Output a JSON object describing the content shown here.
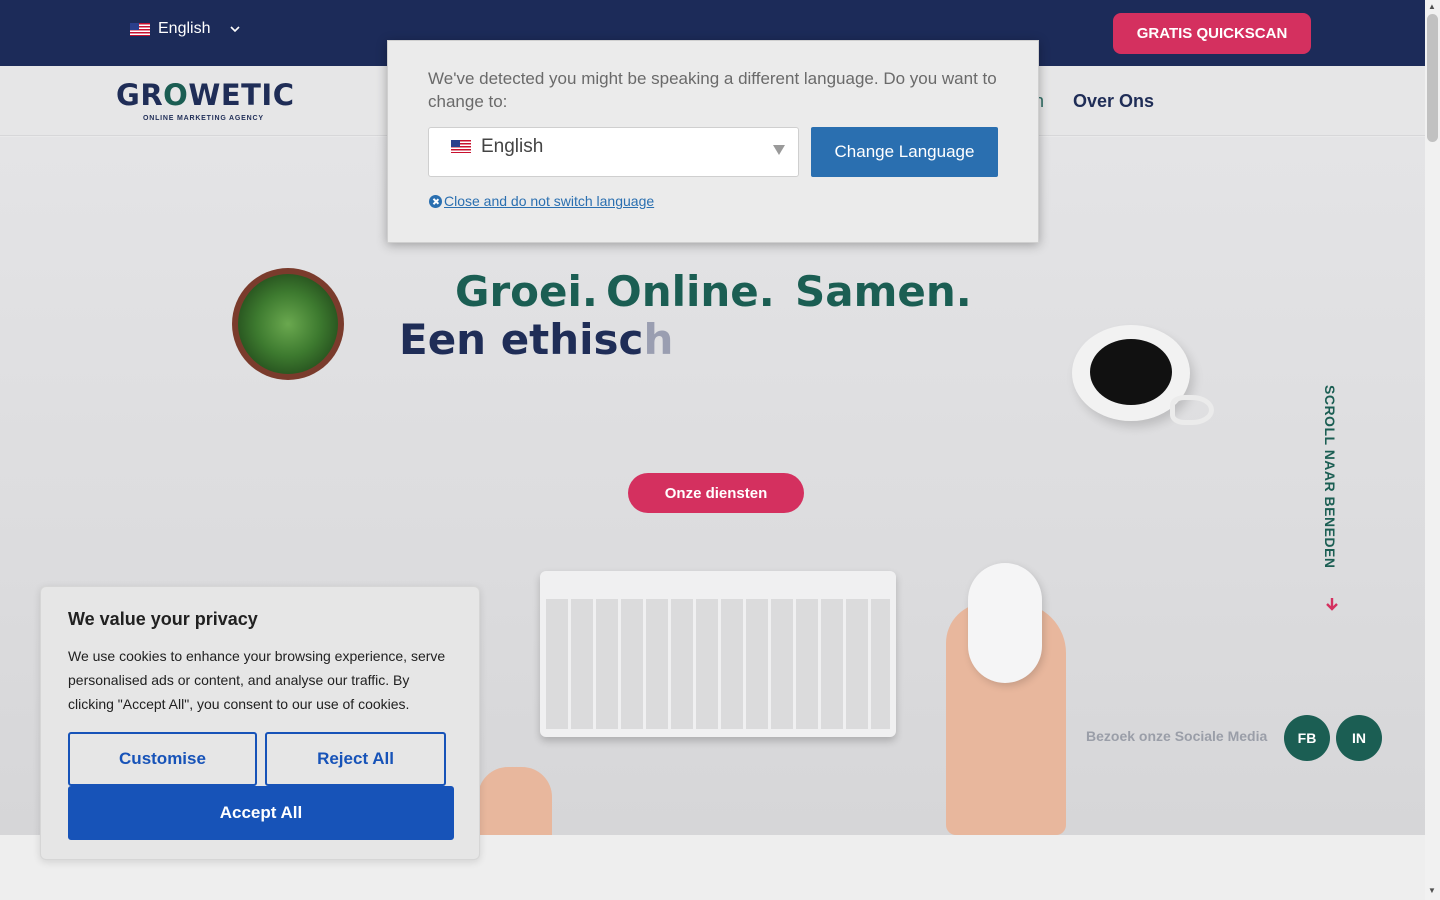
{
  "topbar": {
    "language_label": "English",
    "cta_label": "GRATIS QUICKSCAN"
  },
  "header": {
    "logo_main": "GROWETIC",
    "logo_sub": "ONLINE MARKETING AGENCY",
    "nav_items": [
      "Over Ons"
    ]
  },
  "hero": {
    "line1_words": [
      "Groei.",
      "Online.",
      "Samen."
    ],
    "line2_typed": "Een ethisc",
    "line2_fading": "h",
    "button_label": "Onze diensten",
    "scroll_label": "SCROLL NAAR BENEDEN",
    "social_label": "Bezoek onze Sociale Media",
    "social_buttons": [
      "FB",
      "IN"
    ]
  },
  "language_modal": {
    "message": "We've detected you might be speaking a different language. Do you want to change to:",
    "selected_language": "English",
    "change_button": "Change Language",
    "close_link": "Close and do not switch language"
  },
  "cookie_banner": {
    "title": "We value your privacy",
    "text": "We use cookies to enhance your browsing experience, serve personalised ads or content, and analyse our traffic. By clicking \"Accept All\", you consent to our use of cookies.",
    "customise": "Customise",
    "reject": "Reject All",
    "accept": "Accept All"
  },
  "colors": {
    "navy": "#1c2b59",
    "pink": "#d4305f",
    "green": "#1b5e53",
    "blue": "#1753b8"
  }
}
